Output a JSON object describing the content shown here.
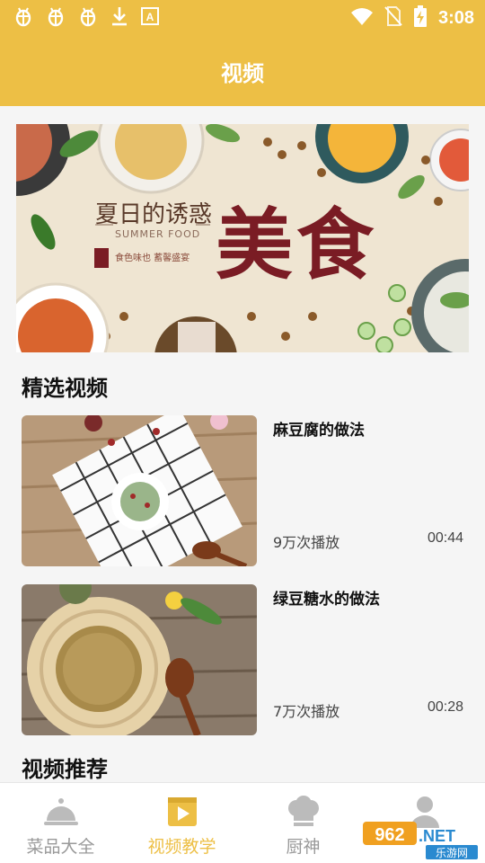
{
  "status_bar": {
    "time": "3:08",
    "left_icons": [
      "bug-icon",
      "bug-icon",
      "bug-icon",
      "download-icon",
      "font-icon"
    ],
    "right_icons": [
      "wifi-icon",
      "no-sim-icon",
      "battery-charging-icon"
    ]
  },
  "header": {
    "title": "视频"
  },
  "banner": {
    "title_small": "夏日的诱惑",
    "subtitle": "SUMMER FOOD",
    "tag": "食色味也  蓄馨盛宴",
    "title_big": "美食"
  },
  "featured": {
    "title": "精选视频",
    "videos": [
      {
        "title": "麻豆腐的做法",
        "plays": "9万次播放",
        "duration": "00:44"
      },
      {
        "title": "绿豆糖水的做法",
        "plays": "7万次播放",
        "duration": "00:28"
      }
    ]
  },
  "recommended": {
    "title": "视频推荐"
  },
  "tabs": [
    {
      "label": "菜品大全",
      "icon": "cloche-icon",
      "active": false
    },
    {
      "label": "视频教学",
      "icon": "video-icon",
      "active": true
    },
    {
      "label": "厨神",
      "icon": "chef-hat-icon",
      "active": false
    },
    {
      "label": "",
      "icon": "person-icon",
      "active": false
    }
  ],
  "watermark": {
    "number": "962",
    "suffix": ".NET",
    "text": "乐游网"
  },
  "colors": {
    "accent": "#edbf45",
    "banner_title": "#7a1c24",
    "inactive": "#999999"
  }
}
